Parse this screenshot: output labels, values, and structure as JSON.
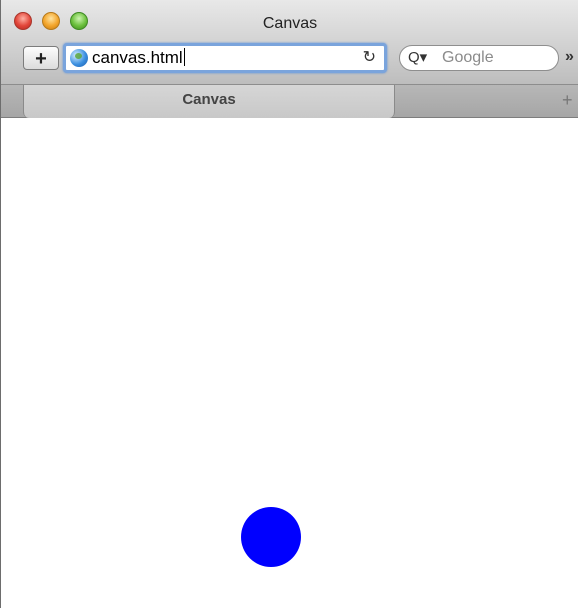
{
  "window": {
    "title": "Canvas"
  },
  "toolbar": {
    "add_label": "+",
    "address_value": "canvas.html",
    "reload_icon": "reload-icon",
    "search_placeholder": "Google",
    "search_icon_glyph": "Q▾",
    "overflow_label": "»"
  },
  "tabs": [
    {
      "label": "Canvas",
      "active": true
    }
  ],
  "tab_new_label": "+",
  "canvas": {
    "ball_color": "#0000ff"
  }
}
